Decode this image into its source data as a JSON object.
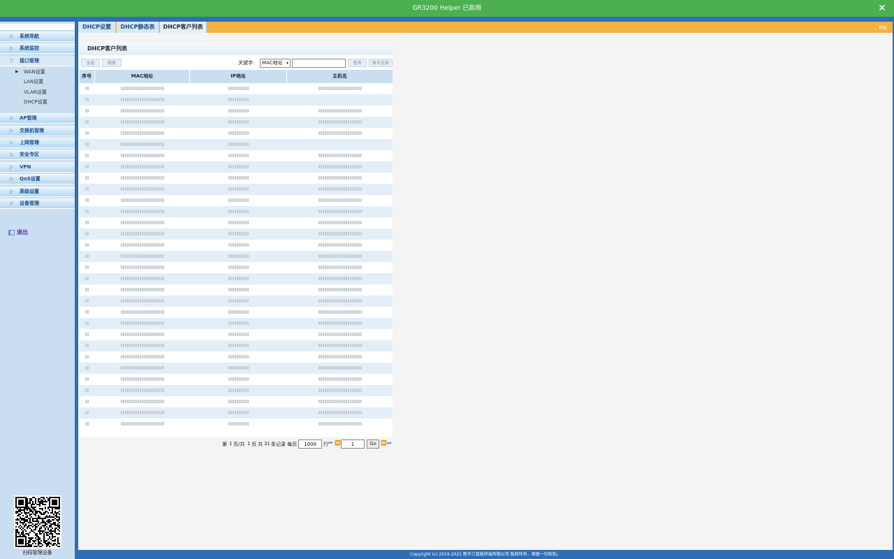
{
  "window": {
    "title": "GR3200 Helper 已启用",
    "close_icon": "close-icon"
  },
  "sidebar": {
    "items": [
      {
        "label": "系统导航",
        "icon": "triangle-right-icon"
      },
      {
        "label": "系统监控",
        "icon": "triangle-right-icon"
      },
      {
        "label": "接口管理",
        "icon": "triangle-down-icon"
      },
      {
        "label": "AP管理",
        "icon": "triangle-right-icon"
      },
      {
        "label": "交换机管理",
        "icon": "triangle-right-icon"
      },
      {
        "label": "上网管理",
        "icon": "triangle-right-icon"
      },
      {
        "label": "安全专区",
        "icon": "triangle-right-icon"
      },
      {
        "label": "VPN",
        "icon": "triangle-right-icon"
      },
      {
        "label": "QoS设置",
        "icon": "triangle-right-icon"
      },
      {
        "label": "高级设置",
        "icon": "triangle-right-icon"
      },
      {
        "label": "设备管理",
        "icon": "triangle-right-icon"
      }
    ],
    "submenu": [
      {
        "label": "WAN设置"
      },
      {
        "label": "LAN设置"
      },
      {
        "label": "VLAN设置"
      },
      {
        "label": "DHCP设置"
      }
    ],
    "logout_label": "退出",
    "qr_caption": "扫码管理设备"
  },
  "tabs": [
    {
      "label": "DHCP设置",
      "active": false
    },
    {
      "label": "DHCP静态表",
      "active": false
    },
    {
      "label": "DHCP客户列表",
      "active": true
    }
  ],
  "help_label": "帮助",
  "panel": {
    "title": "DHCP客户列表",
    "select_all_label": "全选",
    "release_label": "释放",
    "keyword_label": "关键字:",
    "keyword_select_value": "MAC地址",
    "keyword_input_value": "",
    "query_label": "查询",
    "show_all_label": "显示全部"
  },
  "table": {
    "headers": [
      "序号",
      "MAC地址",
      "IP地址",
      "主机名"
    ],
    "row_count": 31
  },
  "pager": {
    "page_prefix": "第",
    "current_page": "1",
    "page_sep": "页/共",
    "total_pages": "1",
    "page_word": "页 共",
    "total_records": "31",
    "records_suffix": "条记录 每页",
    "per_page": "1000",
    "row_word": "行",
    "jump_value": "1",
    "go_label": "Go"
  },
  "footer": {
    "text": "Copyright (c) 2019-2021 新华三智能终端有限公司 版权所有，保留一切权利。"
  },
  "colors": {
    "titlebar": "#4caf50",
    "accent_blue": "#2f6db5",
    "tab_orange": "#f6b13e",
    "sidebar_bg": "#c9dff1"
  }
}
